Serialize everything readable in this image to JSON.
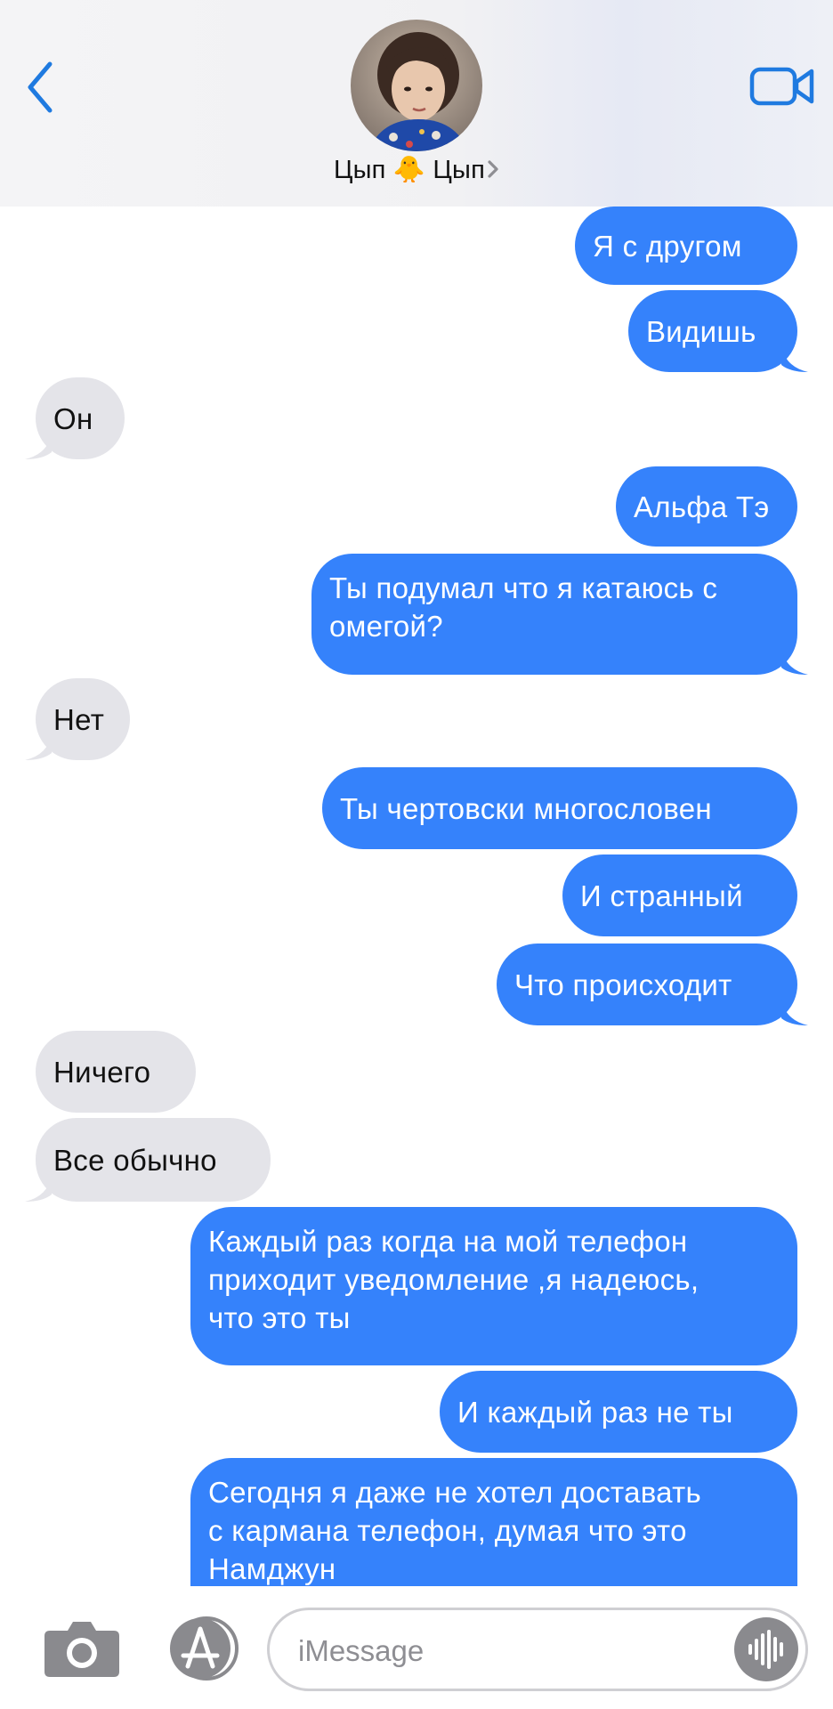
{
  "header": {
    "contact_name": "Цып 🐥 Цып",
    "icons": {
      "back": "chevron-left-icon",
      "video": "video-camera-icon",
      "contact_chevron": "chevron-right-icon"
    }
  },
  "messages": [
    {
      "dir": "out",
      "text": "Я с другом"
    },
    {
      "dir": "out",
      "text": "Видишь"
    },
    {
      "dir": "in",
      "text": "Он"
    },
    {
      "dir": "out",
      "text": "Альфа Тэ"
    },
    {
      "dir": "out",
      "text": "Ты подумал что я катаюсь с\nомегой?"
    },
    {
      "dir": "in",
      "text": "Нет"
    },
    {
      "dir": "out",
      "text": "Ты чертовски многословен"
    },
    {
      "dir": "out",
      "text": "И странный"
    },
    {
      "dir": "out",
      "text": "Что происходит"
    },
    {
      "dir": "in",
      "text": "Ничего"
    },
    {
      "dir": "in",
      "text": "Все обычно"
    },
    {
      "dir": "out",
      "text": "Каждый раз когда на мой телефон\nприходит уведомление ,я надеюсь,\nчто это ты"
    },
    {
      "dir": "out",
      "text": "И каждый раз не ты"
    },
    {
      "dir": "out",
      "text": "Сегодня я даже не хотел доставать\nс кармана телефон, думая что это\nНамджун"
    }
  ],
  "input": {
    "placeholder": "iMessage",
    "icons": {
      "camera": "camera-icon",
      "app_store": "app-store-icon",
      "voice": "waveform-icon"
    }
  },
  "colors": {
    "outgoing": "#3582fb",
    "incoming": "#e4e4e9",
    "accent": "#1f7ae0"
  }
}
